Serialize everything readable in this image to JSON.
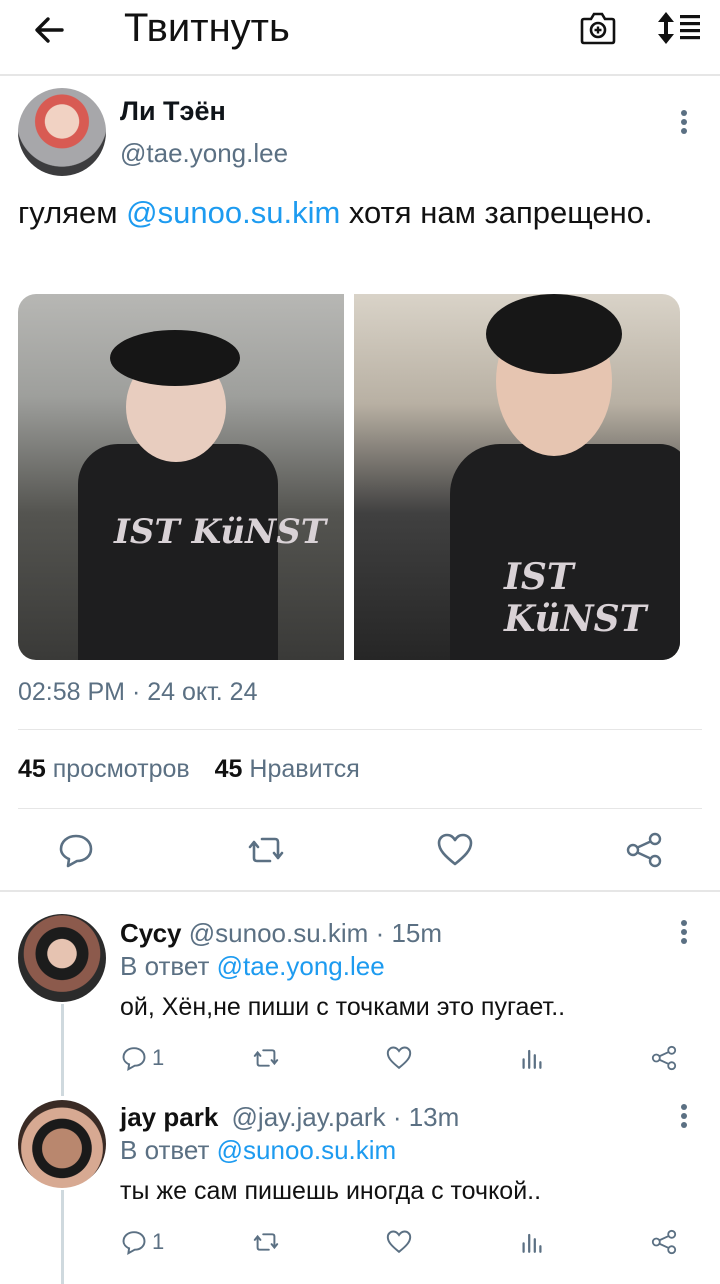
{
  "header": {
    "title": "Твитнуть",
    "back_icon": "arrow-left-icon",
    "camera_icon": "camera-icon",
    "sort_icon": "sort-icon"
  },
  "tweet": {
    "author_name": "Ли Тэён",
    "author_handle": "@tae.yong.lee",
    "text_before": "гуляем ",
    "text_mention": "@sunoo.su.kim",
    "text_after": " хотя нам запрещено.",
    "image_1_text": "IST KüNST",
    "image_2_text": "IST KüNST",
    "timestamp": "02:58 PM · 24 окт. 24",
    "views_count": "45",
    "views_label": "просмотров",
    "likes_count": "45",
    "likes_label": "Нравится"
  },
  "replies": [
    {
      "name": "Сусу",
      "handle": "@sunoo.su.kim",
      "time": "· 15m",
      "reply_prefix": "В ответ ",
      "reply_to": "@tae.yong.lee",
      "text": "ой, Хён,не пиши с точками это пугает..",
      "reply_count": "1"
    },
    {
      "name": "jay park",
      "handle": "@jay.jay.park",
      "time": "· 13m",
      "reply_prefix": "В ответ ",
      "reply_to": "@sunoo.su.kim",
      "text": "ты же сам пишешь иногда с точкой..",
      "reply_count": "1"
    }
  ],
  "colors": {
    "accent": "#1d9bf0",
    "secondary_text": "#5b7083",
    "divider": "#e6e6e6"
  }
}
